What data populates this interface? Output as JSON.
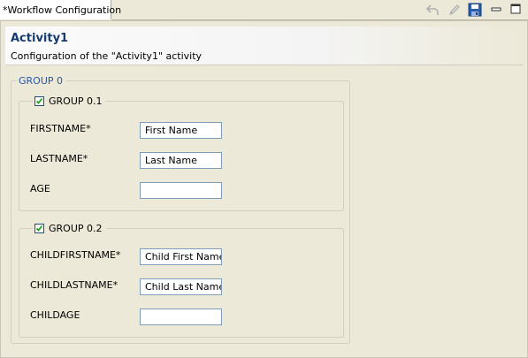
{
  "tab": {
    "title": "*Workflow Configuration"
  },
  "toolbar": {
    "icons": [
      "undo-icon",
      "edit-pencil-icon",
      "save-disk-icon",
      "minimize-icon",
      "maximize-icon"
    ]
  },
  "header": {
    "title": "Activity1",
    "subtitle": "Configuration of the \"Activity1\" activity"
  },
  "group0": {
    "legend": "GROUP 0",
    "subgroups": [
      {
        "legend": "GROUP 0.1",
        "checked": true,
        "fields": [
          {
            "label": "FIRSTNAME*",
            "value": "First Name"
          },
          {
            "label": "LASTNAME*",
            "value": "Last Name"
          },
          {
            "label": "AGE",
            "value": ""
          }
        ]
      },
      {
        "legend": "GROUP 0.2",
        "checked": true,
        "fields": [
          {
            "label": "CHILDFIRSTNAME*",
            "value": "Child First Name"
          },
          {
            "label": "CHILDLASTNAME*",
            "value": "Child Last Name"
          },
          {
            "label": "CHILDAGE",
            "value": ""
          }
        ]
      }
    ]
  },
  "colors": {
    "title": "#153b70",
    "group_legend": "#2855a5",
    "field_border": "#7f9db9",
    "background": "#ece9d8"
  }
}
